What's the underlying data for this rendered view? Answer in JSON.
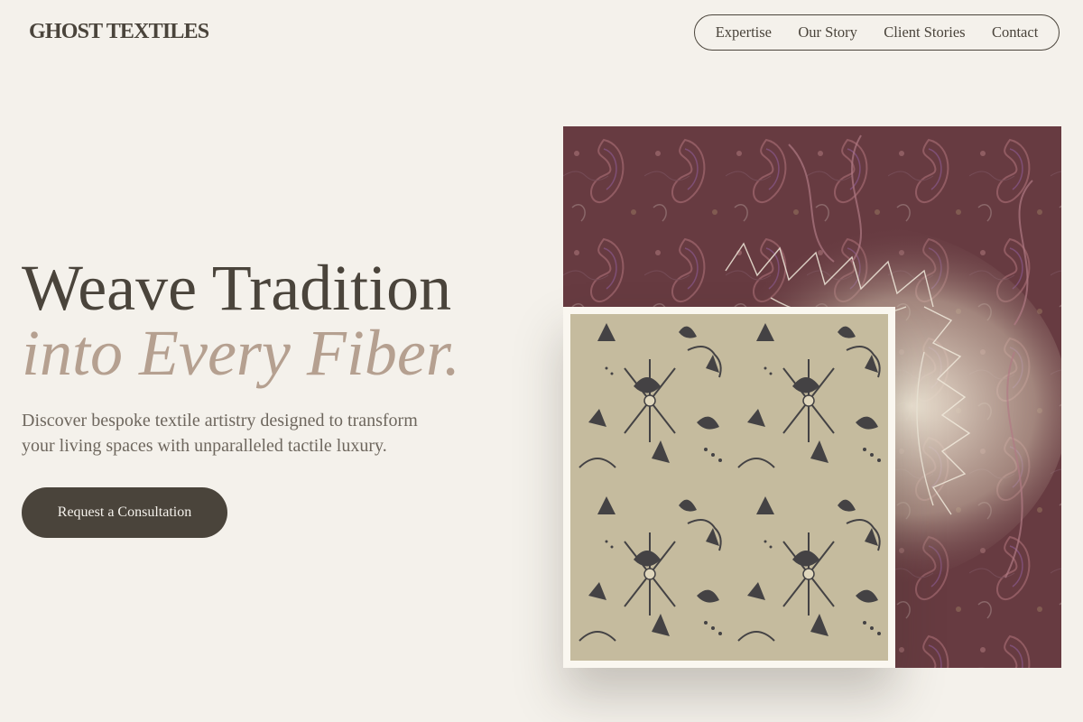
{
  "brand": {
    "name": "GHOST TEXTILES"
  },
  "nav": {
    "items": [
      "Expertise",
      "Our Story",
      "Client Stories",
      "Contact"
    ]
  },
  "hero": {
    "headline_line1": "Weave Tradition",
    "headline_line2": "into Every Fiber.",
    "subtext": "Discover bespoke textile artistry designed to transform your living spaces with unparalleled tactile luxury.",
    "cta_label": "Request a Consultation"
  },
  "colors": {
    "background": "#f4f1eb",
    "text_dark": "#4a443b",
    "accent_italic": "#b5a090",
    "button_bg": "#4a443b",
    "paisley_base": "#6b3f45",
    "batik_base": "#c7bea2"
  },
  "images": {
    "back": "paisley-shawl-textile",
    "front": "batik-floral-textile"
  }
}
